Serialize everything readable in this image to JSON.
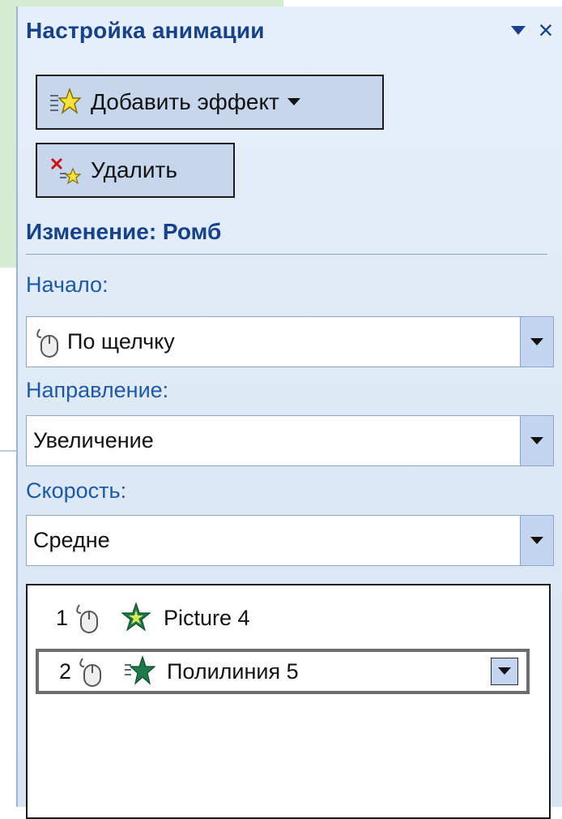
{
  "pane": {
    "title": "Настройка анимации",
    "menu_icon": "dropdown-triangle-icon",
    "close_label": "×"
  },
  "toolbar": {
    "add_effect_label": "Добавить эффект",
    "remove_label": "Удалить"
  },
  "effect": {
    "section_title": "Изменение: Ромб",
    "start": {
      "label": "Начало:",
      "value": "По щелчку"
    },
    "direction": {
      "label": "Направление:",
      "value": "Увеличение"
    },
    "speed": {
      "label": "Скорость:",
      "value": "Средне"
    }
  },
  "animation_list": {
    "items": [
      {
        "number": "1",
        "name": "Picture 4",
        "selected": false
      },
      {
        "number": "2",
        "name": "Полилиния 5",
        "selected": true
      }
    ]
  },
  "colors": {
    "accent": "#15428b",
    "label": "#1c5aa7",
    "pane_bg": "#dde8f6",
    "button_bg": "#c6d6ec",
    "star_green": "#1f7a4a"
  }
}
